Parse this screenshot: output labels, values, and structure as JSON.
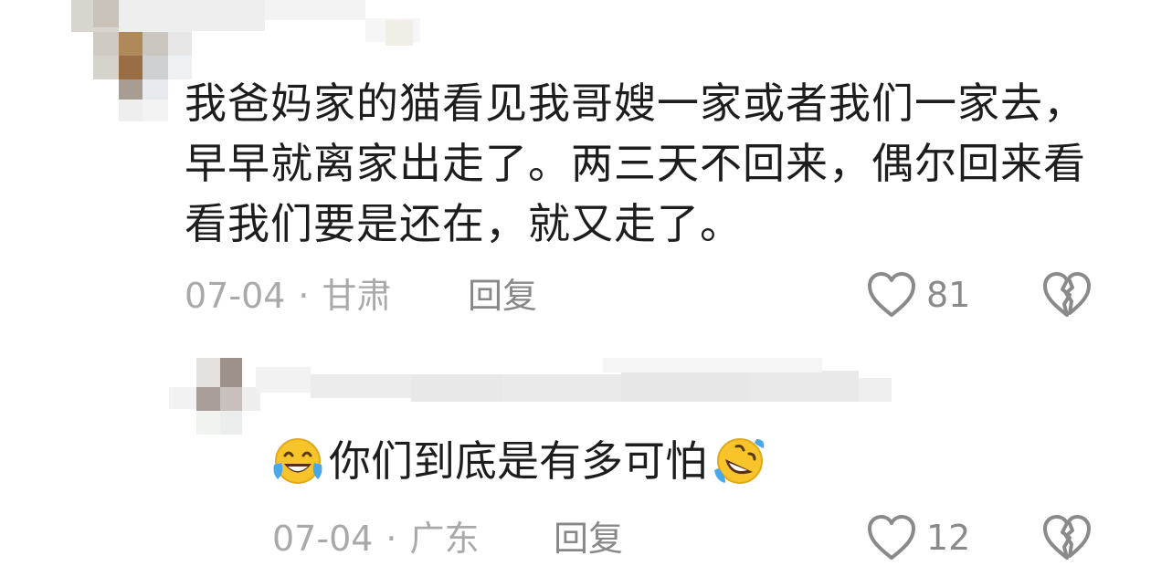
{
  "comment": {
    "text": "我爸妈家的猫看见我哥嫂一家或者我们一家去，早早就离家出走了。两三天不回来，偶尔回来看看我们要是还在，就又走了。",
    "date": "07-04",
    "separator": "·",
    "location": "甘肃",
    "reply_label": "回复",
    "like_count": "81",
    "icons": {
      "like": "heart-outline-icon",
      "dislike": "broken-heart-icon"
    }
  },
  "reply": {
    "text": "你们到底是有多可怕",
    "emoji_before": "crying-laughing-emoji",
    "emoji_after": "rolling-laughing-emoji",
    "date": "07-04",
    "separator": "·",
    "location": "广东",
    "reply_label": "回复",
    "like_count": "12",
    "icons": {
      "like": "heart-outline-icon",
      "dislike": "broken-heart-icon"
    }
  },
  "colors": {
    "text": "#1d1d1d",
    "meta": "#a9a9a9",
    "icon": "#8a8a8a",
    "emoji_yellow": "#f7c52a",
    "emoji_tear": "#4aa8e8"
  }
}
